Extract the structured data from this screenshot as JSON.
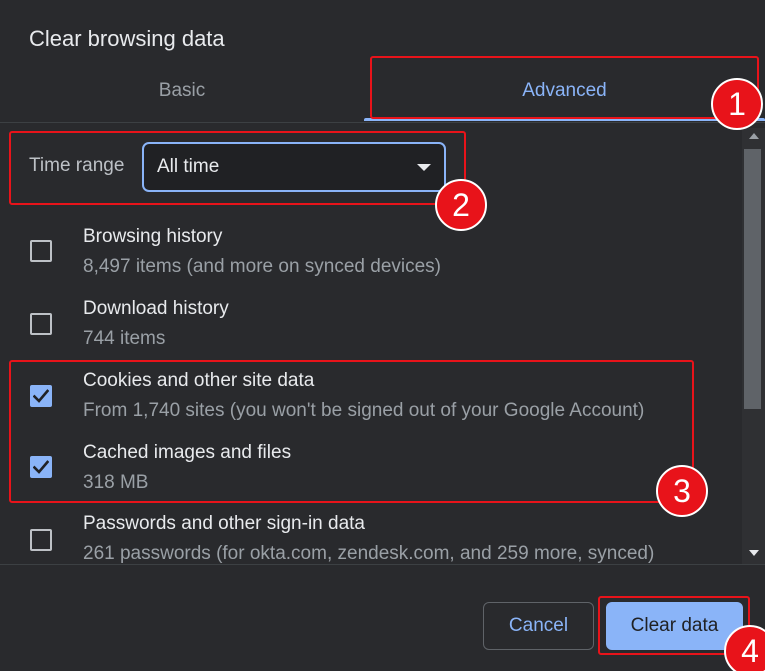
{
  "dialog": {
    "title": "Clear browsing data"
  },
  "tabs": [
    {
      "label": "Basic",
      "active": false
    },
    {
      "label": "Advanced",
      "active": true
    }
  ],
  "time_range": {
    "label": "Time range",
    "value": "All time"
  },
  "items": [
    {
      "title": "Browsing history",
      "subtitle": "8,497 items (and more on synced devices)",
      "checked": false
    },
    {
      "title": "Download history",
      "subtitle": "744 items",
      "checked": false
    },
    {
      "title": "Cookies and other site data",
      "subtitle": "From 1,740 sites (you won't be signed out of your Google Account)",
      "checked": true
    },
    {
      "title": "Cached images and files",
      "subtitle": "318 MB",
      "checked": true
    },
    {
      "title": "Passwords and other sign-in data",
      "subtitle": "261 passwords (for okta.com, zendesk.com, and 259 more, synced)",
      "checked": false
    }
  ],
  "buttons": {
    "cancel_label": "Cancel",
    "clear_label": "Clear data"
  },
  "annotations": [
    "1",
    "2",
    "3",
    "4"
  ],
  "colors": {
    "background": "#292a2d",
    "accent": "#8ab4f8",
    "annotation": "#e8131a"
  }
}
